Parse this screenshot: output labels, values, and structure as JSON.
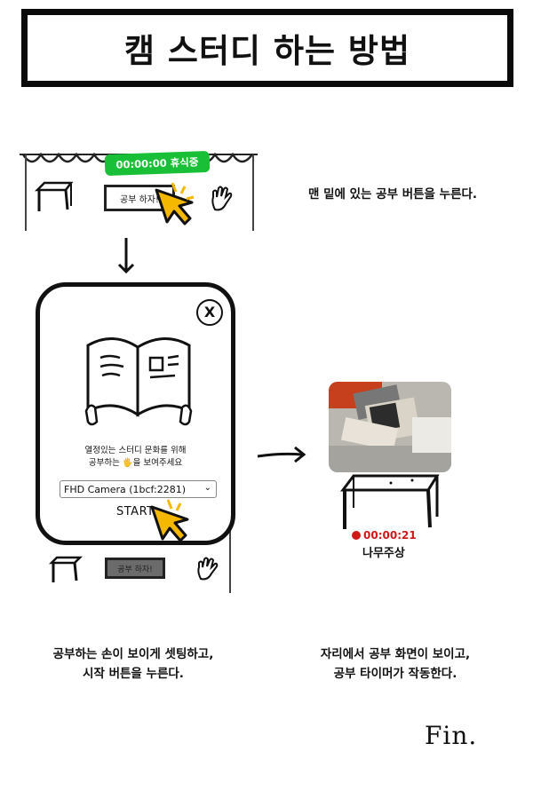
{
  "title": "캠 스터디 하는 방법",
  "step1": {
    "timer_badge": "00:00:00 휴식중",
    "study_button": "공부 하자!",
    "instruction": "맨 밑에 있는 공부 버튼을 누른다."
  },
  "step2": {
    "close_label": "X",
    "prompt_line1": "열정있는 스터디 문화를 위해",
    "prompt_line2": "공부하는 🖐을 보여주세요",
    "camera_selected": "FHD Camera (1bcf:2281)",
    "start_label": "START",
    "study_button": "공부 하자!",
    "instruction_line1": "공부하는 손이 보이게 셋팅하고,",
    "instruction_line2": "시작 버튼을 누른다."
  },
  "step3": {
    "timer": "00:00:21",
    "username": "나무주상",
    "instruction_line1": "자리에서 공부 화면이 보이고,",
    "instruction_line2": "공부 타이머가 작동한다."
  },
  "ending": "Fin.",
  "colors": {
    "green": "#19c037",
    "yellow": "#f5b800",
    "red": "#d01818"
  },
  "icons": [
    "cursor-arrow-icon",
    "table-icon",
    "hand-icon",
    "book-icon",
    "stopwatch-icon",
    "arrow-down-icon",
    "arrow-right-icon"
  ]
}
